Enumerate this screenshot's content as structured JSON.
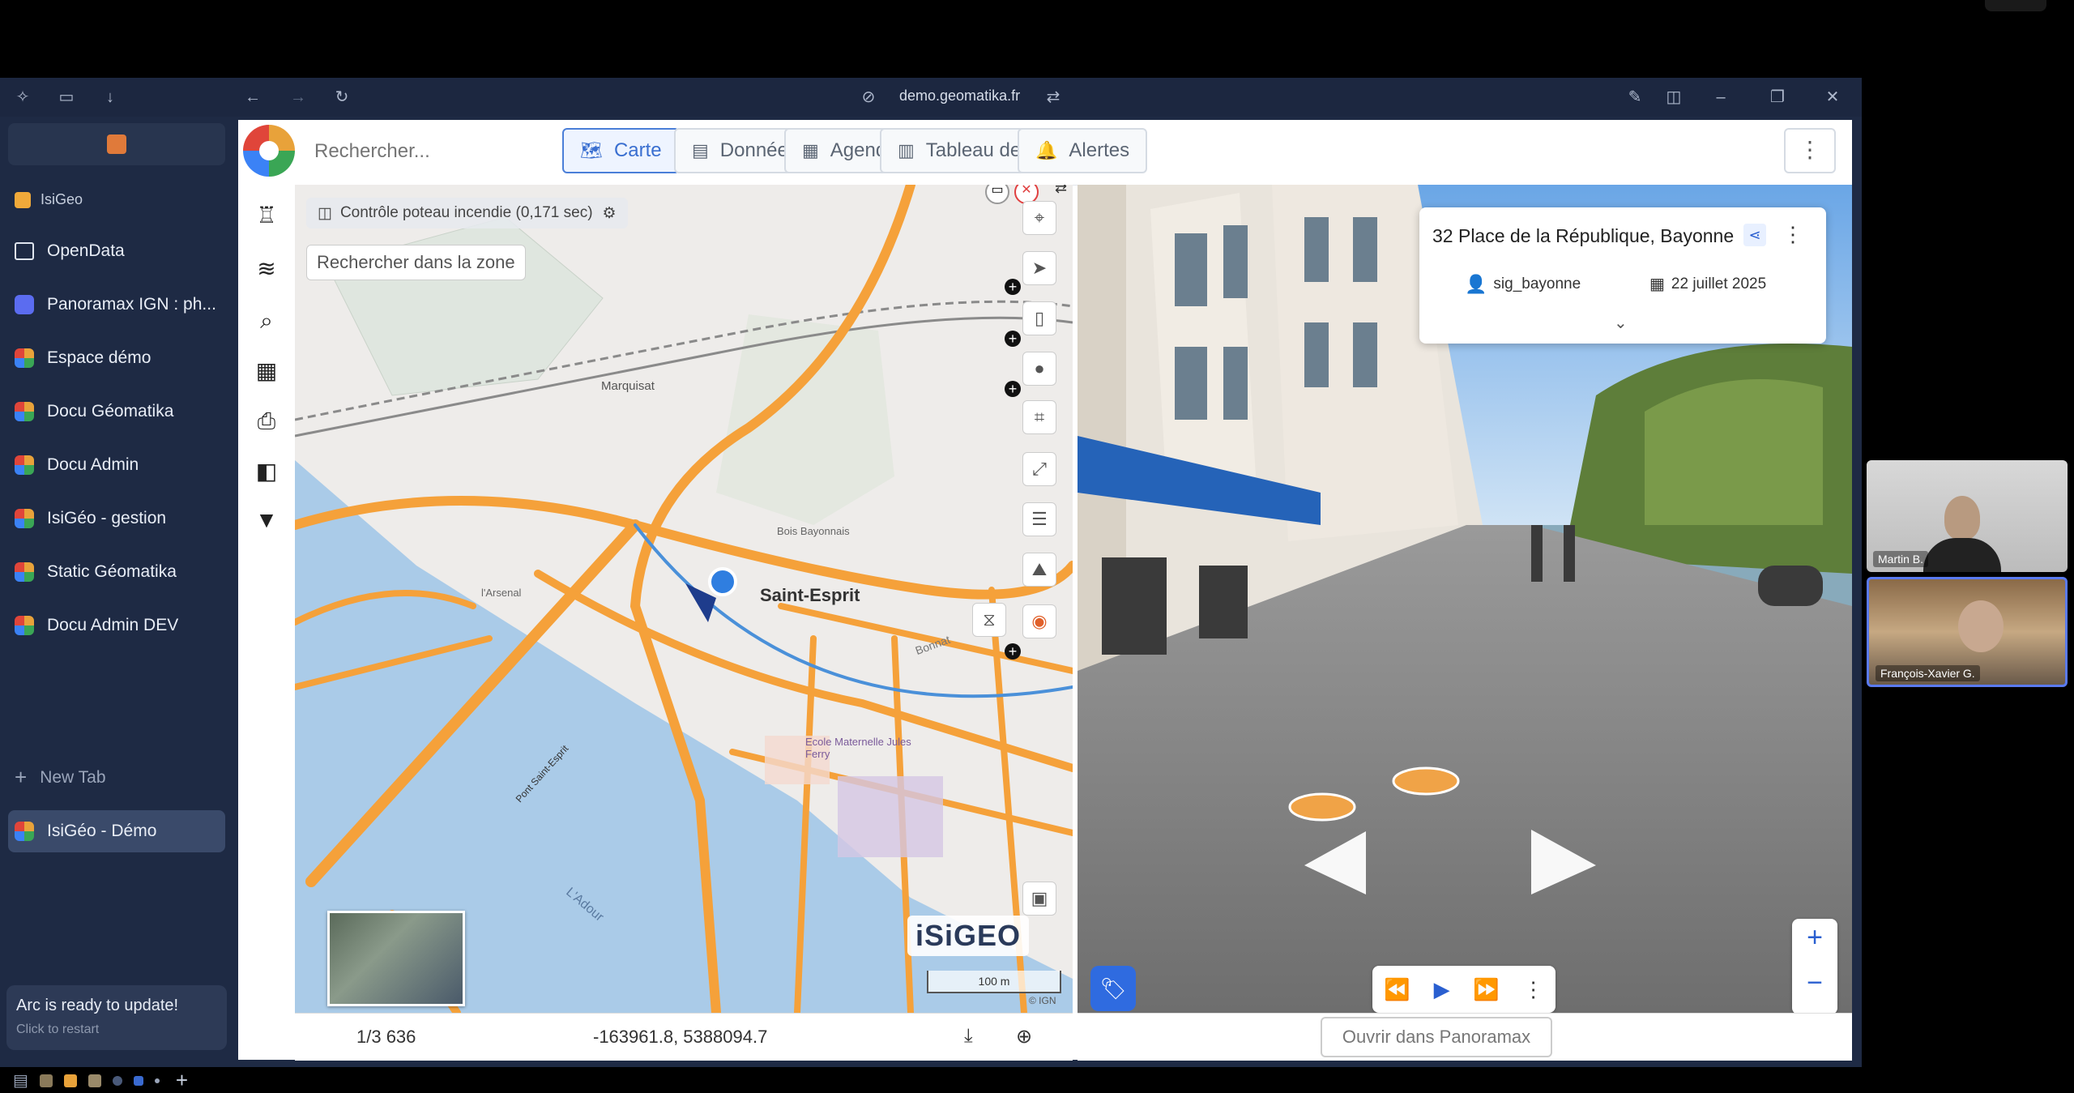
{
  "browser": {
    "url": "demo.geomatika.fr"
  },
  "sidebar": {
    "section_label": "IsiGeo",
    "items": [
      {
        "label": "OpenData",
        "color": "#ffffff"
      },
      {
        "label": "Panoramax IGN : ph...",
        "color": "#5b6cf0"
      },
      {
        "label": "Espace démo",
        "color": "#e8a23a"
      },
      {
        "label": "Docu Géomatika",
        "color": "#e8a23a"
      },
      {
        "label": "Docu Admin",
        "color": "#e8a23a"
      },
      {
        "label": "IsiGéo - gestion",
        "color": "#e8a23a"
      },
      {
        "label": "Static Géomatika",
        "color": "#e8a23a"
      },
      {
        "label": "Docu Admin DEV",
        "color": "#e8a23a"
      }
    ],
    "new_tab": "New Tab",
    "active_tab": "IsiGéo - Démo",
    "update_title": "Arc is ready to update!",
    "update_sub": "Click to restart"
  },
  "app": {
    "search_placeholder": "Rechercher...",
    "tabs": [
      {
        "label": "Carte",
        "icon": "map-icon",
        "active": true
      },
      {
        "label": "Données",
        "icon": "table-icon",
        "active": false
      },
      {
        "label": "Agenda",
        "icon": "calendar-icon",
        "active": false
      },
      {
        "label": "Tableau de bord",
        "icon": "chart-icon",
        "active": false
      },
      {
        "label": "Alertes",
        "icon": "bell-icon",
        "active": false
      }
    ]
  },
  "map": {
    "layer_status": "Contrôle poteau incendie (0,171 sec)",
    "zone_search": "Rechercher dans la zone",
    "labels": {
      "marquisat": "Marquisat",
      "saint_esprit": "Saint-Esprit",
      "bois": "Bois Bayonnais",
      "arsenal": "l'Arsenal",
      "ecole": "Ecole Maternelle Jules Ferry",
      "adour": "L'Adour",
      "pont": "Pont Saint-Esprit",
      "bonnat": "Bonnat"
    },
    "logo": "iSiGEO",
    "scale_label": "100 m",
    "attribution": "© IGN",
    "scale": "1/3 636",
    "coordinates": "-163961.8, 5388094.7"
  },
  "panorama": {
    "address": "32 Place de la République, Bayonne",
    "author": "sig_bayonne",
    "date": "22 juillet 2025",
    "open_button": "Ouvrir dans Panoramax"
  },
  "participants": [
    {
      "name": "Martin B."
    },
    {
      "name": "François-Xavier G."
    }
  ]
}
